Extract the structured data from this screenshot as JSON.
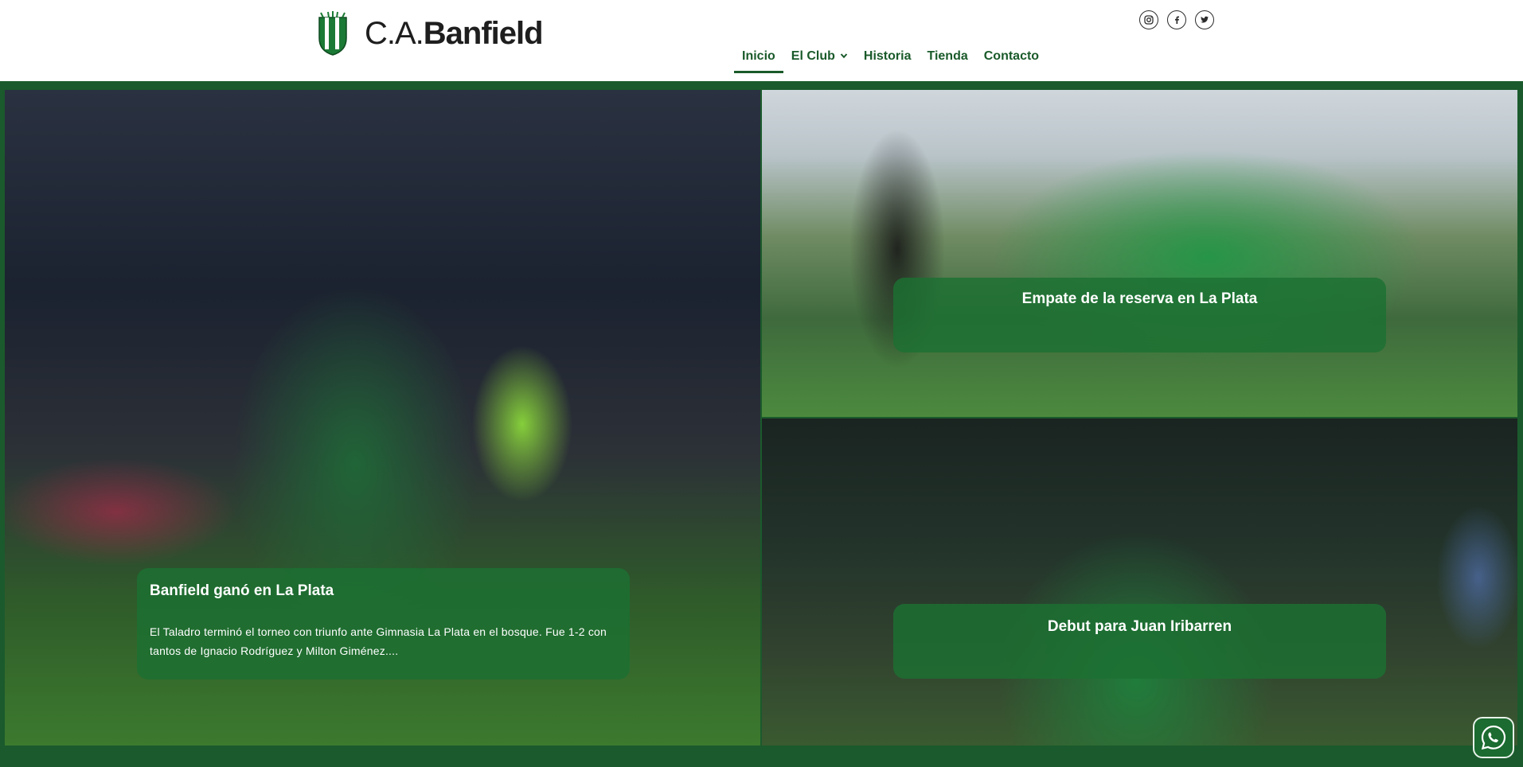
{
  "brand": {
    "name_prefix": "C.A.",
    "name_main": "Banfield"
  },
  "social": [
    "instagram-icon",
    "facebook-icon",
    "twitter-icon"
  ],
  "nav": {
    "items": [
      {
        "label": "Inicio",
        "active": true
      },
      {
        "label": "El Club",
        "has_dropdown": true
      },
      {
        "label": "Historia"
      },
      {
        "label": "Tienda"
      },
      {
        "label": "Contacto"
      }
    ]
  },
  "news": [
    {
      "title": "Banfield ganó en La Plata",
      "excerpt": "El Taladro terminó el torneo con triunfo ante Gimnasia La Plata en el bosque. Fue 1-2 con tantos de Ignacio Rodríguez y Milton Giménez...."
    },
    {
      "title": "Empate de la reserva en La Plata"
    },
    {
      "title": "Debut para Juan Iribarren"
    }
  ],
  "colors": {
    "brand_green": "#1b5a2c",
    "caption_bg": "#1c7032",
    "nav_text": "#1a5a2a"
  }
}
